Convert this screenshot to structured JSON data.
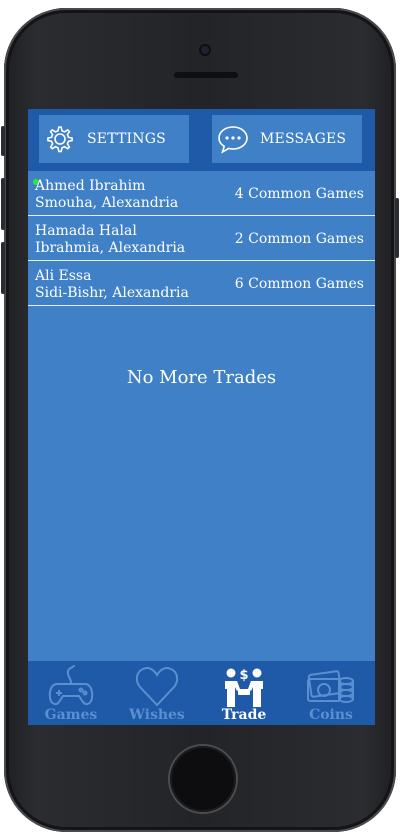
{
  "header": {
    "settings_label": "SETTINGS",
    "messages_label": "MESSAGES"
  },
  "trades": [
    {
      "name": "Ahmed Ibrahim",
      "location": "Smouha, Alexandria",
      "common": "4 Common Games",
      "online": true
    },
    {
      "name": "Hamada Halal",
      "location": "Ibrahmia, Alexandria",
      "common": "2 Common Games",
      "online": false
    },
    {
      "name": "Ali Essa",
      "location": "Sidi-Bishr, Alexandria",
      "common": "6 Common Games",
      "online": false
    }
  ],
  "empty_message": "No More Trades",
  "tabs": [
    {
      "label": "Games",
      "icon": "gamepad-icon",
      "active": false
    },
    {
      "label": "Wishes",
      "icon": "heart-icon",
      "active": false
    },
    {
      "label": "Trade",
      "icon": "trade-people-icon",
      "active": true
    },
    {
      "label": "Coins",
      "icon": "coins-icon",
      "active": false
    }
  ],
  "colors": {
    "header": "#1f5aa8",
    "panel": "#3f80c6",
    "tab_inactive": "#5b8fd0",
    "online": "#2ee83a"
  }
}
